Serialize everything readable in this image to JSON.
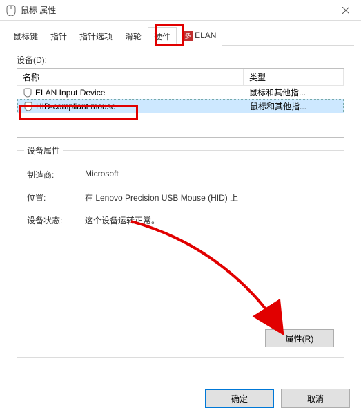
{
  "window": {
    "title": "鼠标 属性"
  },
  "tabs": [
    {
      "label": "鼠标键"
    },
    {
      "label": "指针"
    },
    {
      "label": "指针选项"
    },
    {
      "label": "滑轮"
    },
    {
      "label": "硬件",
      "active": true
    },
    {
      "label": "ELAN",
      "icon": "多"
    }
  ],
  "devices_label": "设备(D):",
  "columns": {
    "name": "名称",
    "type": "类型"
  },
  "devices": [
    {
      "name": "ELAN Input Device",
      "type": "鼠标和其他指..."
    },
    {
      "name": "HID-compliant mouse",
      "type": "鼠标和其他指...",
      "selected": true
    }
  ],
  "group": {
    "title": "设备属性",
    "manufacturer_label": "制造商:",
    "manufacturer": "Microsoft",
    "location_label": "位置:",
    "location": "在 Lenovo Precision USB Mouse (HID) 上",
    "status_label": "设备状态:",
    "status": "这个设备运转正常。",
    "properties_button": "属性(R)"
  },
  "buttons": {
    "ok": "确定",
    "cancel": "取消"
  }
}
